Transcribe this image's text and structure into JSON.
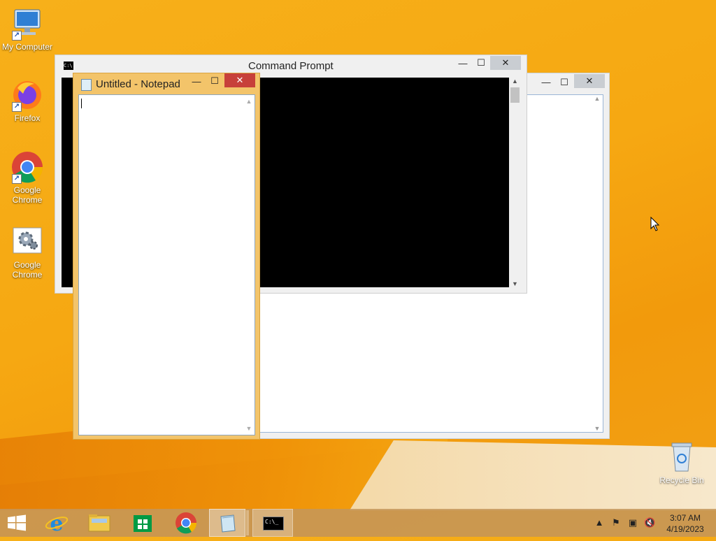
{
  "desktop": {
    "icons": [
      {
        "label": "My Computer"
      },
      {
        "label": "Firefox"
      },
      {
        "label": "Google\nChrome"
      },
      {
        "label": "Google\nChrome"
      },
      {
        "label": "Recycle Bin"
      }
    ]
  },
  "windows": {
    "cmd": {
      "title": "Command Prompt",
      "icon_text": "C:\\."
    },
    "notepad": {
      "title": "Untitled - Notepad"
    }
  },
  "caption_buttons": {
    "minimize": "—",
    "maximize": "☐",
    "close": "✕"
  },
  "taskbar": {
    "clock_time": "3:07 AM",
    "clock_date": "4/19/2023",
    "cmd_icon_text": "C:\\_"
  },
  "colors": {
    "accent_window": "#f3c46a",
    "close_red": "#c7403a",
    "desktop_orange": "#f6a812"
  }
}
